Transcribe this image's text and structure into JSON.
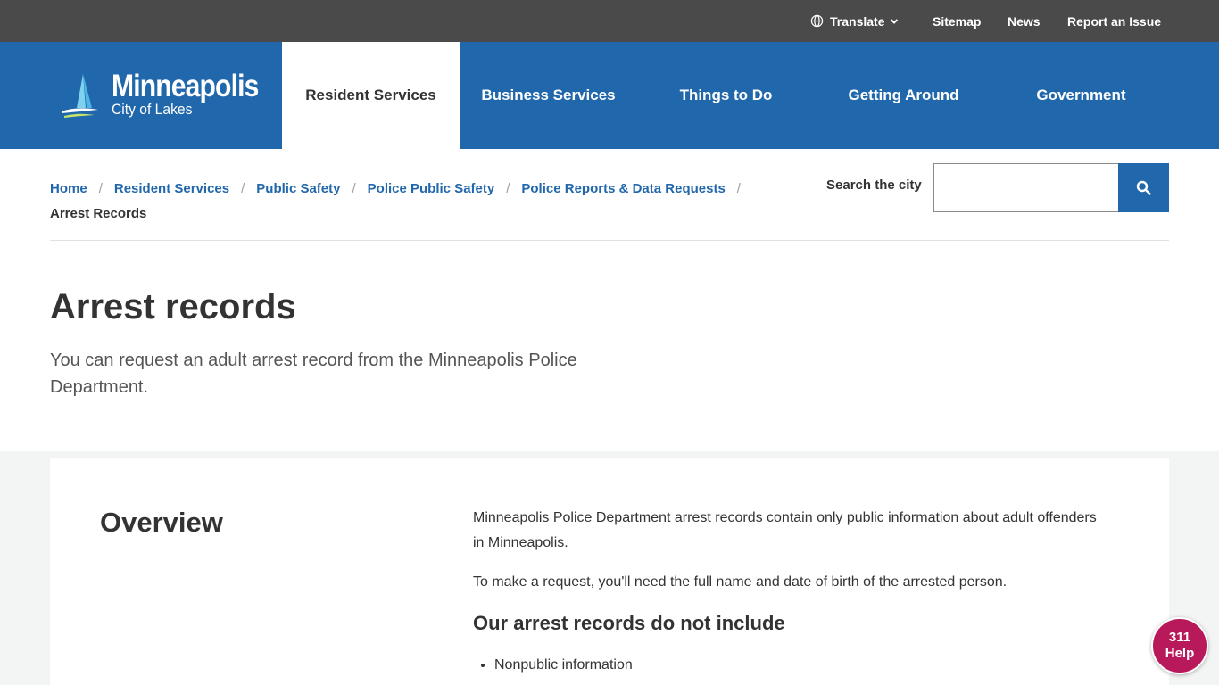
{
  "utility": {
    "translate": "Translate",
    "sitemap": "Sitemap",
    "news": "News",
    "report": "Report an Issue"
  },
  "logo": {
    "name": "Minneapolis",
    "tagline": "City of Lakes"
  },
  "nav": {
    "items": [
      {
        "label": "Resident Services",
        "active": true
      },
      {
        "label": "Business Services"
      },
      {
        "label": "Things to Do"
      },
      {
        "label": "Getting Around"
      },
      {
        "label": "Government"
      }
    ]
  },
  "breadcrumb": {
    "items": [
      "Home",
      "Resident Services",
      "Public Safety",
      "Police Public Safety",
      "Police Reports & Data Requests"
    ],
    "separator": "/",
    "current": "Arrest Records"
  },
  "search": {
    "label": "Search the city",
    "value": ""
  },
  "page": {
    "title": "Arrest records",
    "lede": "You can request an adult arrest record from the Minneapolis Police Department."
  },
  "overview": {
    "title": "Overview",
    "paragraphs": [
      "Minneapolis Police Department arrest records contain only public information about adult offenders in Minneapolis.",
      "To make a request, you'll need the full name and date of birth of the arrested person."
    ],
    "subhead": "Our arrest records do not include",
    "bullets": [
      "Nonpublic information"
    ]
  },
  "help": {
    "number": "311",
    "label": "Help"
  },
  "colors": {
    "brand_blue": "#2167ac",
    "utility_bar": "#4a4a4a",
    "help_magenta": "#b8195a",
    "content_bg": "#f3f4f4"
  }
}
